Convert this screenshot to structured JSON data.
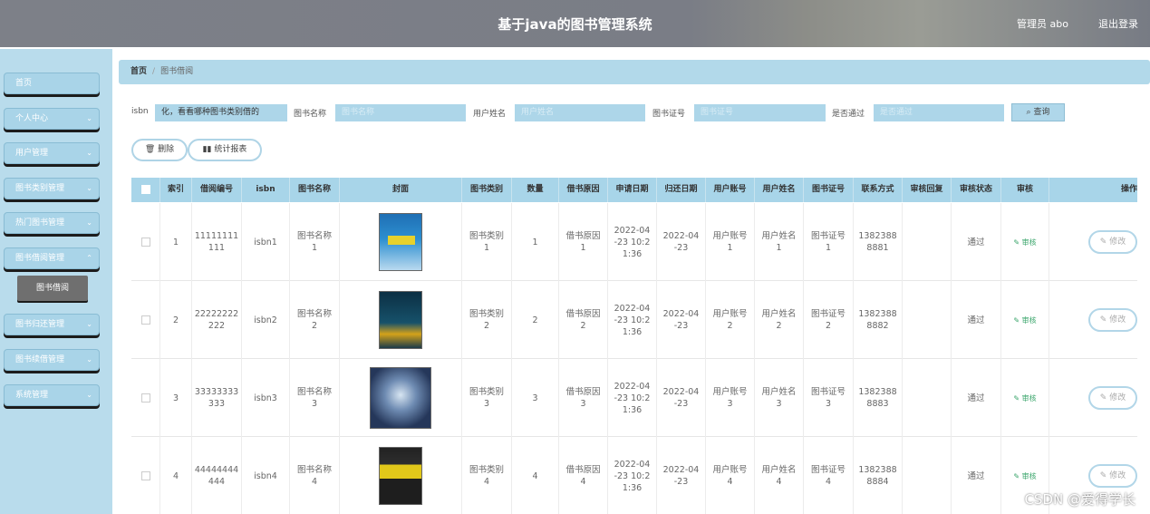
{
  "header": {
    "title": "基于java的图书管理系统",
    "user": "管理员 abo",
    "logout": "退出登录"
  },
  "sidebar": {
    "items": [
      {
        "label": "首页",
        "chevron": ""
      },
      {
        "label": "个人中心",
        "chevron": "⌄"
      },
      {
        "label": "用户管理",
        "chevron": "⌄"
      },
      {
        "label": "图书类别管理",
        "chevron": "⌄"
      },
      {
        "label": "热门图书管理",
        "chevron": "⌄"
      },
      {
        "label": "图书借阅管理",
        "chevron": "⌃"
      },
      {
        "label": "图书归还管理",
        "chevron": "⌄"
      },
      {
        "label": "图书续借管理",
        "chevron": "⌄"
      },
      {
        "label": "系统管理",
        "chevron": "⌄"
      }
    ],
    "active_sub": "图书借阅"
  },
  "breadcrumb": {
    "home": "首页",
    "sep": "/",
    "current": "图书借阅"
  },
  "search": {
    "isbn_label": "isbn",
    "isbn_value": "化，看看哪种图书类别借的",
    "name_label": "图书名称",
    "name_placeholder": "图书名称",
    "user_label": "用户姓名",
    "user_placeholder": "用户姓名",
    "card_label": "图书证号",
    "card_placeholder": "图书证号",
    "pass_label": "是否通过",
    "pass_placeholder": "是否通过",
    "button": "查询",
    "button_icon": "search-icon"
  },
  "actions": {
    "delete": "删除",
    "stats": "统计报表"
  },
  "table": {
    "headers": [
      "",
      "索引",
      "借阅编号",
      "isbn",
      "图书名称",
      "封面",
      "图书类别",
      "数量",
      "借书原因",
      "申请日期",
      "归还日期",
      "用户账号",
      "用户姓名",
      "图书证号",
      "联系方式",
      "审核回复",
      "审核状态",
      "审核",
      "操作"
    ],
    "rows": [
      {
        "idx": "1",
        "no": [
          "11111111",
          "111"
        ],
        "isbn": "isbn1",
        "name": [
          "图书名称",
          "1"
        ],
        "cat": [
          "图书类别",
          "1"
        ],
        "qty": "1",
        "reason": [
          "借书原因",
          "1"
        ],
        "apply": [
          "2022-04",
          "-23 10:2",
          "1:36"
        ],
        "ret": [
          "2022-04",
          "-23"
        ],
        "acct": [
          "用户账号",
          "1"
        ],
        "uname": [
          "用户姓名",
          "1"
        ],
        "card": [
          "图书证号",
          "1"
        ],
        "phone": [
          "1382388",
          "8881"
        ],
        "reply": "",
        "status": "通过",
        "review": "审核",
        "edit": "修改"
      },
      {
        "idx": "2",
        "no": [
          "22222222",
          "222"
        ],
        "isbn": "isbn2",
        "name": [
          "图书名称",
          "2"
        ],
        "cat": [
          "图书类别",
          "2"
        ],
        "qty": "2",
        "reason": [
          "借书原因",
          "2"
        ],
        "apply": [
          "2022-04",
          "-23 10:2",
          "1:36"
        ],
        "ret": [
          "2022-04",
          "-23"
        ],
        "acct": [
          "用户账号",
          "2"
        ],
        "uname": [
          "用户姓名",
          "2"
        ],
        "card": [
          "图书证号",
          "2"
        ],
        "phone": [
          "1382388",
          "8882"
        ],
        "reply": "",
        "status": "通过",
        "review": "审核",
        "edit": "修改"
      },
      {
        "idx": "3",
        "no": [
          "33333333",
          "333"
        ],
        "isbn": "isbn3",
        "name": [
          "图书名称",
          "3"
        ],
        "cat": [
          "图书类别",
          "3"
        ],
        "qty": "3",
        "reason": [
          "借书原因",
          "3"
        ],
        "apply": [
          "2022-04",
          "-23 10:2",
          "1:36"
        ],
        "ret": [
          "2022-04",
          "-23"
        ],
        "acct": [
          "用户账号",
          "3"
        ],
        "uname": [
          "用户姓名",
          "3"
        ],
        "card": [
          "图书证号",
          "3"
        ],
        "phone": [
          "1382388",
          "8883"
        ],
        "reply": "",
        "status": "通过",
        "review": "审核",
        "edit": "修改"
      },
      {
        "idx": "4",
        "no": [
          "44444444",
          "444"
        ],
        "isbn": "isbn4",
        "name": [
          "图书名称",
          "4"
        ],
        "cat": [
          "图书类别",
          "4"
        ],
        "qty": "4",
        "reason": [
          "借书原因",
          "4"
        ],
        "apply": [
          "2022-04",
          "-23 10:2",
          "1:36"
        ],
        "ret": [
          "2022-04",
          "-23"
        ],
        "acct": [
          "用户账号",
          "4"
        ],
        "uname": [
          "用户姓名",
          "4"
        ],
        "card": [
          "图书证号",
          "4"
        ],
        "phone": [
          "1382388",
          "8884"
        ],
        "reply": "",
        "status": "通过",
        "review": "审核",
        "edit": "修改"
      }
    ]
  },
  "watermark": "CSDN @爱得学长"
}
